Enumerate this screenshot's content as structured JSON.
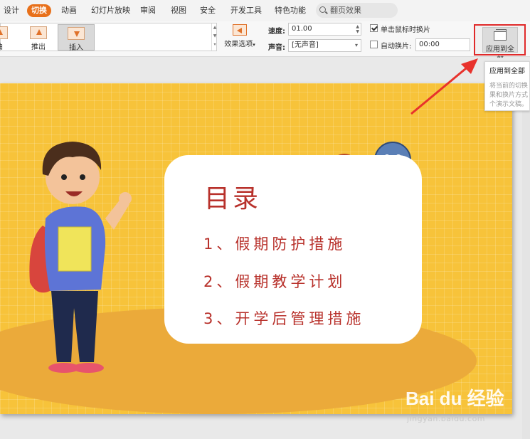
{
  "menubar": {
    "items": [
      "设计",
      "切换",
      "动画",
      "幻灯片放映",
      "审阅",
      "视图",
      "安全",
      "开发工具",
      "特色功能"
    ],
    "active_index": 1,
    "search_placeholder": "翻页效果"
  },
  "ribbon": {
    "gallery": [
      {
        "label": "曲"
      },
      {
        "label": "推出"
      },
      {
        "label": "插入",
        "selected": true
      }
    ],
    "effect_options_label": "效果选项",
    "speed_label": "速度:",
    "speed_value": "01.00",
    "sound_label": "声音:",
    "sound_value": "[无声音]",
    "on_click_label": "单击鼠标时换片",
    "on_click_checked": true,
    "auto_label": "自动换片:",
    "auto_checked": false,
    "auto_value": "00:00",
    "apply_all_label": "应用到全部"
  },
  "tooltip": {
    "title": "应用到全部",
    "lines": [
      "将当前的切换",
      "果和换片方式",
      "个演示文稿。"
    ]
  },
  "slide": {
    "title": "目录",
    "items": [
      "1、假期防护措施",
      "2、假期教学计划",
      "3、开学后管理措施"
    ],
    "colors": {
      "background": "#f7c33a",
      "text": "#b8312b",
      "card": "#ffffff"
    }
  },
  "watermark": {
    "brand": "Bai du 经验",
    "url": "jingyan.baidu.com"
  }
}
